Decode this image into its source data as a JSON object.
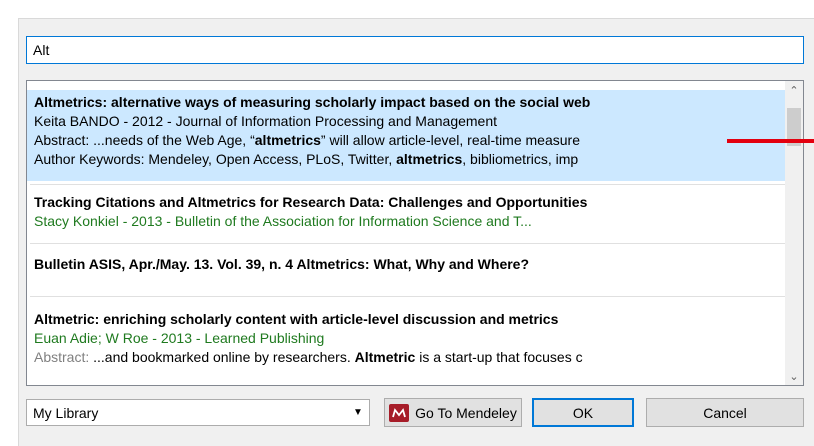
{
  "search": {
    "value": "Alt"
  },
  "results": [
    {
      "title": "Altmetrics: alternative ways of measuring scholarly impact based on the social web",
      "meta": "Keita BANDO - 2012 - Journal of Information Processing and Management",
      "abstract_prefix": "Abstract: ...needs of the Web Age, “",
      "abstract_bold": "altmetrics",
      "abstract_suffix": "” will allow article-level, real-time measure",
      "keywords_prefix": "Author Keywords: Mendeley, Open Access, PLoS, Twitter, ",
      "keywords_bold": "altmetrics",
      "keywords_suffix": ", bibliometrics, imp",
      "selected": true
    },
    {
      "title": "Tracking Citations and Altmetrics for Research Data: Challenges and Opportunities",
      "meta": "Stacy Konkiel - 2013 - Bulletin of the Association for Information Science and T..."
    },
    {
      "title": "Bulletin ASIS, Apr./May. 13. Vol. 39, n. 4 Altmetrics: What, Why and Where?"
    },
    {
      "title": "Altmetric: enriching scholarly content with article-level discussion and metrics",
      "meta": "Euan Adie; W Roe - 2013 - Learned Publishing",
      "abstract_label": "Abstract: ",
      "abstract_prefix": "...and bookmarked online by researchers. ",
      "abstract_bold": "Altmetric",
      "abstract_suffix": " is a start-up that focuses c"
    }
  ],
  "library_select": {
    "value": "My Library"
  },
  "buttons": {
    "go_to_mendeley": "Go To Mendeley",
    "ok": "OK",
    "cancel": "Cancel"
  },
  "icons": {
    "mendeley_logo": "mendeley-logo-icon",
    "dropdown": "chevron-down-icon",
    "scroll_up": "chevron-up-icon",
    "scroll_down": "chevron-down-icon"
  },
  "colors": {
    "selection": "#cce8ff",
    "focus_border": "#0078d7",
    "meta_green": "#1f7a1f",
    "marker_red": "#e3000f",
    "mendeley_red": "#a61c28"
  }
}
